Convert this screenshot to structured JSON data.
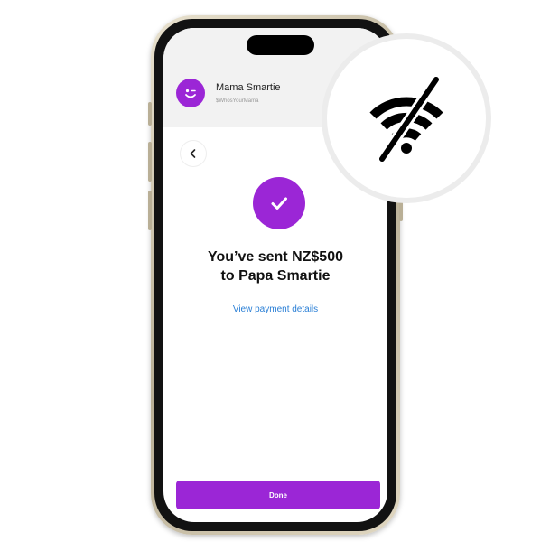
{
  "header": {
    "name": "Mama Smartie",
    "handle": "$WhosYourMama"
  },
  "confirmation": {
    "line1": "You’ve sent NZ$500",
    "line2": "to Papa Smartie",
    "details_link": "View payment details"
  },
  "actions": {
    "done_label": "Done"
  },
  "icons": {
    "avatar": "winking-smiley-icon",
    "back": "chevron-left-icon",
    "success": "checkmark-icon",
    "offline": "wifi-off-icon"
  },
  "colors": {
    "brand_purple": "#9b26d6",
    "link_blue": "#2a7fd6"
  }
}
